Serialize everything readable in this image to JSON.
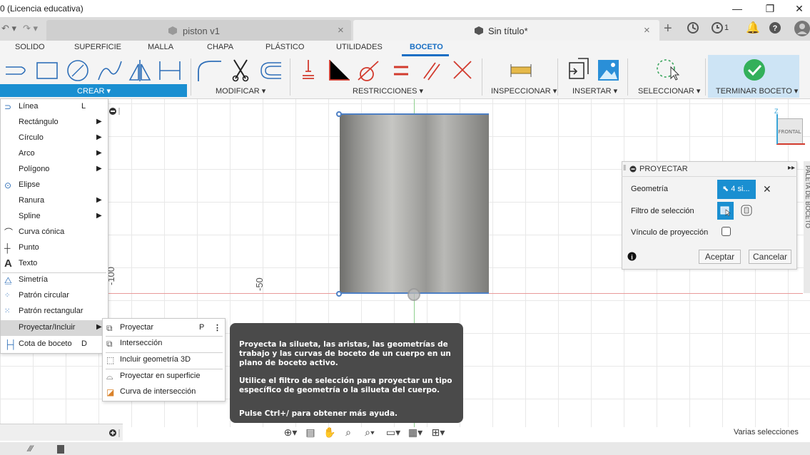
{
  "window": {
    "title": "0 (Licencia educativa)",
    "minimize": "—",
    "restore": "❐",
    "close": "✕"
  },
  "tabs": [
    {
      "label": "piston v1",
      "close": "×"
    },
    {
      "label": "Sin título*",
      "close": "×"
    }
  ],
  "tabbar_icons": {
    "add": "+",
    "jobs_count": "1"
  },
  "ribbon": {
    "tabs": [
      "SOLIDO",
      "SUPERFICIE",
      "MALLA",
      "CHAPA",
      "PLÁSTICO",
      "UTILIDADES",
      "BOCETO"
    ],
    "active_tab": "BOCETO",
    "groups": {
      "crear": "CREAR ▾",
      "modificar": "MODIFICAR ▾",
      "restricciones": "RESTRICCIONES ▾",
      "inspeccionar": "INSPECCIONAR ▾",
      "insertar": "INSERTAR ▾",
      "seleccionar": "SELECCIONAR ▾",
      "terminar": "TERMINAR BOCETO ▾"
    }
  },
  "crear_menu": {
    "items": [
      {
        "label": "Línea",
        "shortcut": "L"
      },
      {
        "label": "Rectángulo",
        "arrow": "▶"
      },
      {
        "label": "Círculo",
        "arrow": "▶"
      },
      {
        "label": "Arco",
        "arrow": "▶"
      },
      {
        "label": "Polígono",
        "arrow": "▶"
      },
      {
        "label": "Elipse"
      },
      {
        "label": "Ranura",
        "arrow": "▶"
      },
      {
        "label": "Spline",
        "arrow": "▶"
      },
      {
        "label": "Curva cónica"
      },
      {
        "label": "Punto"
      },
      {
        "label": "Texto"
      },
      {
        "label": "Simetría"
      },
      {
        "label": "Patrón circular"
      },
      {
        "label": "Patrón rectangular"
      },
      {
        "label": "Proyectar/Incluir",
        "arrow": "▶"
      },
      {
        "label": "Cota de boceto",
        "shortcut": "D"
      }
    ]
  },
  "submenu": {
    "items": [
      {
        "label": "Proyectar",
        "shortcut": "P",
        "more": "⋮"
      },
      {
        "label": "Intersección"
      },
      {
        "label": "Incluir geometría 3D"
      },
      {
        "label": "Proyectar en superficie"
      },
      {
        "label": "Curva de intersección"
      }
    ]
  },
  "tooltip": {
    "p1": "Proyecta la silueta, las aristas, las geometrías de trabajo y las curvas de boceto de un cuerpo en un plano de boceto activo.",
    "p2": "Utilice el filtro de selección para proyectar un tipo específico de geometría o la silueta del cuerpo.",
    "p3": "Pulse Ctrl+/ para obtener más ayuda."
  },
  "proyectar_panel": {
    "title": "PROYECTAR",
    "geometria_label": "Geometría",
    "geometria_value": "4 si...",
    "filtro_label": "Filtro de selección",
    "vinculo_label": "Vínculo de proyección",
    "vinculo_checked": false,
    "aceptar": "Aceptar",
    "cancelar": "Cancelar"
  },
  "canvas": {
    "dim_labels": [
      "-100",
      "-50"
    ],
    "viewcube_face": "FRONTAL",
    "axis_label": "Z",
    "side_palette": "PALETA DE BOCETO"
  },
  "status": {
    "selection_text": "Varias selecciones"
  },
  "colors": {
    "accent": "#1a8fd1",
    "ribbon_active": "#1a6fc4",
    "tooltip_bg": "#4a4a4a",
    "terminar_check": "#33b05a"
  }
}
